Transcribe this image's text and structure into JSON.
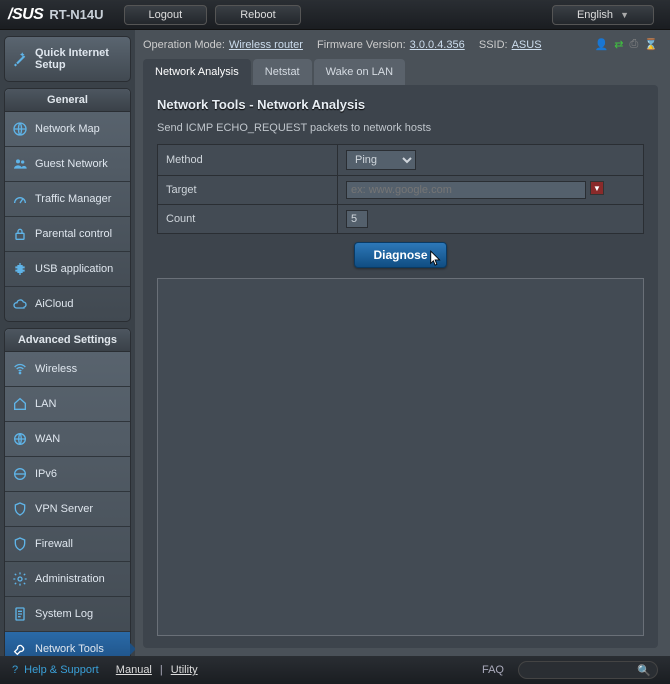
{
  "top": {
    "brand": "/SUS",
    "model": "RT-N14U",
    "logout": "Logout",
    "reboot": "Reboot",
    "language": "English"
  },
  "info": {
    "op_mode_label": "Operation Mode:",
    "op_mode": "Wireless router",
    "fw_label": "Firmware Version:",
    "fw": "3.0.0.4.356",
    "ssid_label": "SSID:",
    "ssid": "ASUS"
  },
  "sidebar": {
    "quick": "Quick Internet Setup",
    "general_header": "General",
    "general": [
      "Network Map",
      "Guest Network",
      "Traffic Manager",
      "Parental control",
      "USB application",
      "AiCloud"
    ],
    "advanced_header": "Advanced Settings",
    "advanced": [
      "Wireless",
      "LAN",
      "WAN",
      "IPv6",
      "VPN Server",
      "Firewall",
      "Administration",
      "System Log",
      "Network Tools"
    ]
  },
  "tabs": [
    "Network Analysis",
    "Netstat",
    "Wake on LAN"
  ],
  "panel": {
    "title": "Network Tools - Network Analysis",
    "desc": "Send ICMP ECHO_REQUEST packets to network hosts",
    "method_label": "Method",
    "method_value": "Ping",
    "target_label": "Target",
    "target_placeholder": "ex: www.google.com",
    "count_label": "Count",
    "count_value": "5",
    "diagnose": "Diagnose"
  },
  "footer": {
    "help": "Help & Support",
    "manual": "Manual",
    "utility": "Utility",
    "faq": "FAQ"
  }
}
